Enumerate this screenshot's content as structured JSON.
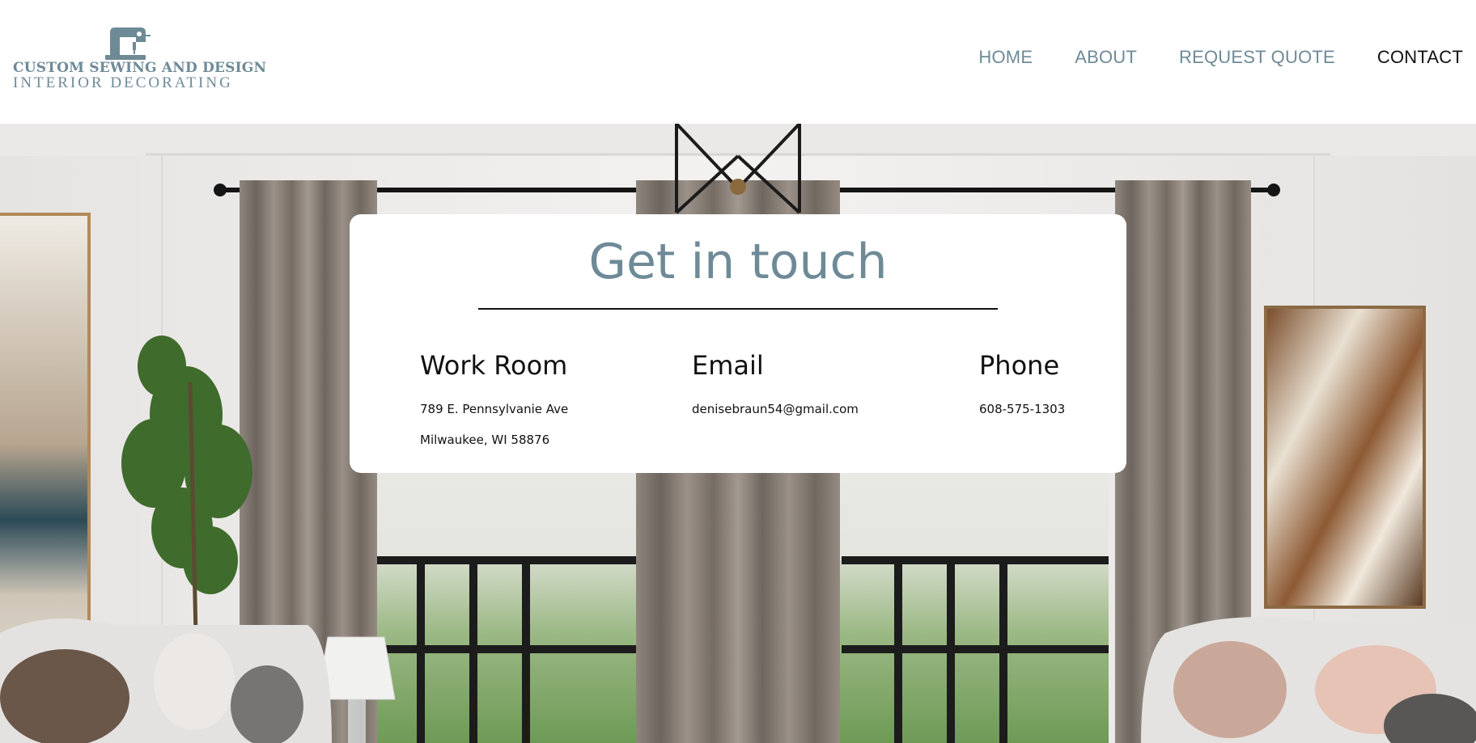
{
  "header": {
    "logo": {
      "icon": "sewing-machine-icon",
      "line1": "CUSTOM SEWING AND DESIGN",
      "line2": "INTERIOR DECORATING"
    },
    "nav": [
      {
        "label": "HOME",
        "active": false
      },
      {
        "label": "ABOUT",
        "active": false
      },
      {
        "label": "REQUEST QUOTE",
        "active": false
      },
      {
        "label": "CONTACT",
        "active": true
      }
    ]
  },
  "contact_card": {
    "title": "Get in touch",
    "columns": [
      {
        "heading": "Work Room",
        "lines": [
          "789 E. Pennsylvanie Ave",
          "Milwaukee, WI 58876"
        ]
      },
      {
        "heading": "Email",
        "lines": [
          "denisebraun54@gmail.com"
        ]
      },
      {
        "heading": "Phone",
        "lines": [
          "608-575-1303"
        ]
      }
    ]
  },
  "colors": {
    "accent": "#6e8a97",
    "active_nav": "#111111",
    "card_bg": "#ffffff"
  }
}
